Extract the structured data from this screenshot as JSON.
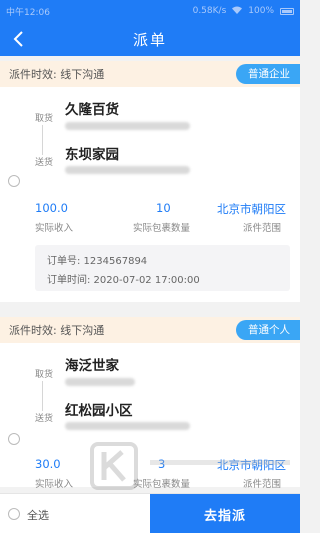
{
  "status_bar": {
    "carrier": "中午12:06",
    "speed": "0.58K/s",
    "battery": "100%"
  },
  "header": {
    "title": "派单"
  },
  "orders": [
    {
      "timeliness": "派件时效: 线下沟通",
      "customer_type": "普通企业",
      "pickup_label": "取货",
      "pickup_name": "久隆百货",
      "delivery_label": "送货",
      "delivery_name": "东坝家园",
      "income": "100.0",
      "income_label": "实际收入",
      "package_count": "10",
      "package_label": "实际包裹数量",
      "region": "北京市朝阳区",
      "region_label": "派件范围",
      "order_no": "订单号: 1234567894",
      "order_time": "订单时间: 2020-07-02 17:00:00"
    },
    {
      "timeliness": "派件时效: 线下沟通",
      "customer_type": "普通个人",
      "pickup_label": "取货",
      "pickup_name": "海泛世家",
      "delivery_label": "送货",
      "delivery_name": "红松园小区",
      "income": "30.0",
      "income_label": "实际收入",
      "package_count": "3",
      "package_label": "实际包裹数量",
      "region": "北京市朝阳区",
      "region_label": "派件范围"
    }
  ],
  "footer": {
    "select_all": "全选",
    "assign_button": "去指派"
  },
  "colors": {
    "primary": "#1f7cf6",
    "tag": "#3aa6f5",
    "head_bg": "#fdf1e3"
  }
}
